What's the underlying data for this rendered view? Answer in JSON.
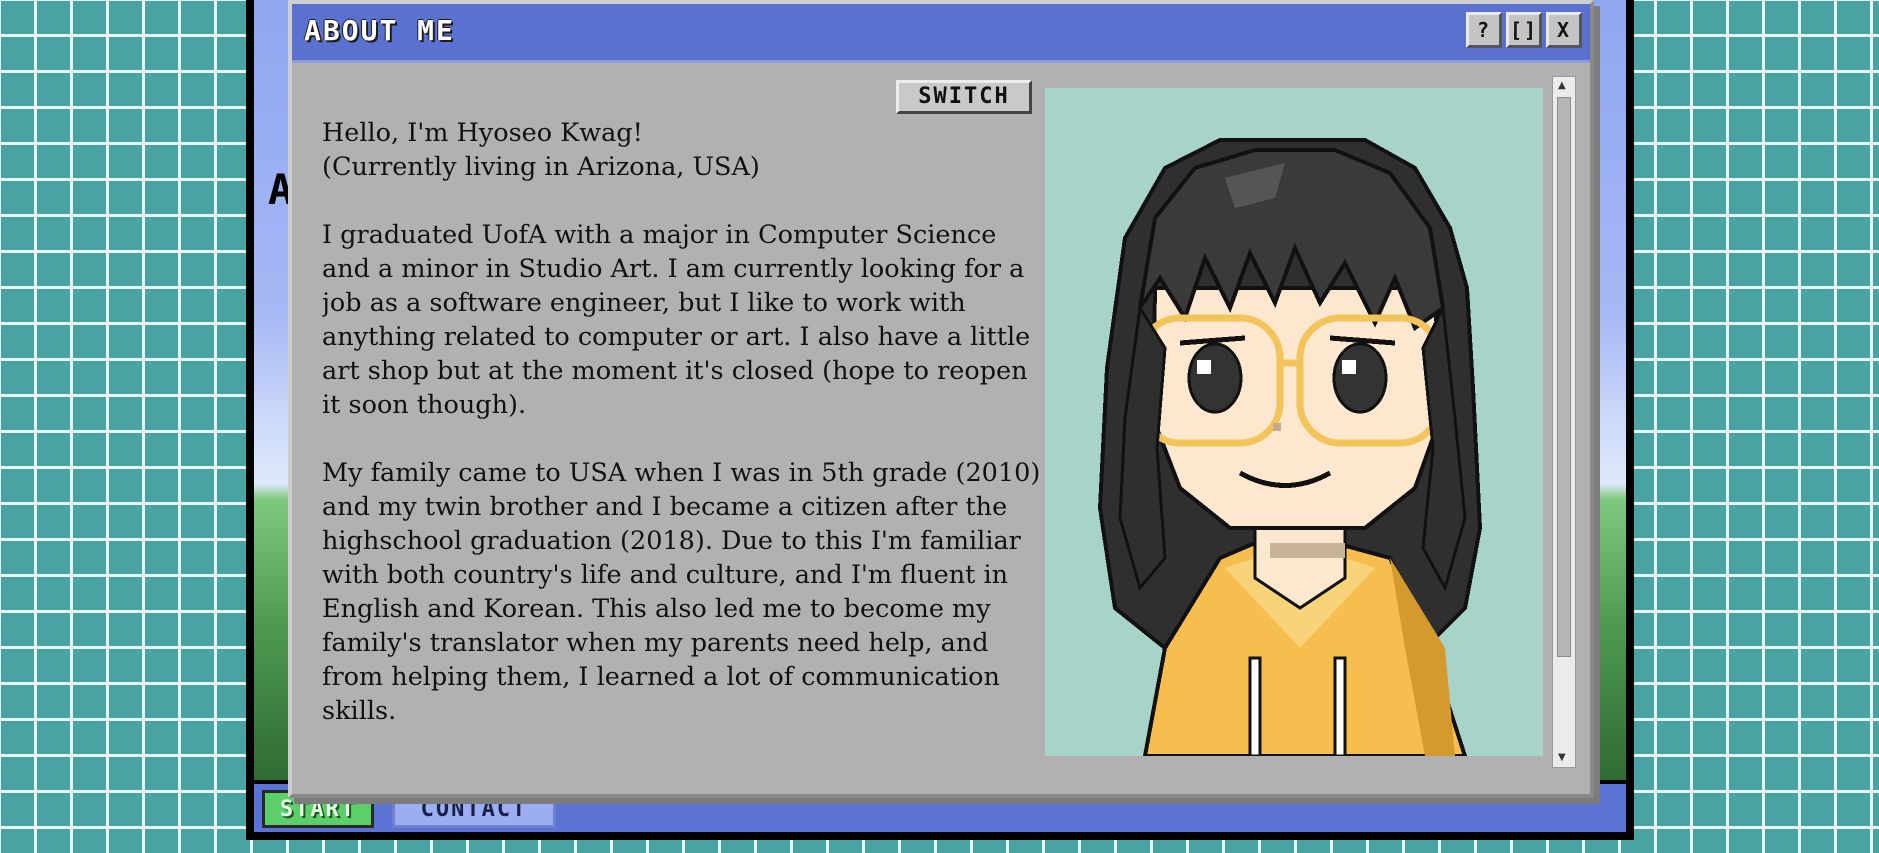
{
  "window": {
    "title": "ABOUT ME",
    "help_label": "?",
    "maximize_label": "[]",
    "close_label": "X"
  },
  "switch_label": "SWITCH",
  "background": {
    "partial_heading": "A"
  },
  "taskbar": {
    "start_label": "START",
    "contact_label": "CONTACT"
  },
  "about": {
    "intro": "Hello, I'm Hyoseo Kwag!\n(Currently living in Arizona, USA)",
    "career": "I graduated UofA with a major in Computer Science and a minor in Studio Art. I am currently looking for a job as a software engineer, but I like to work with anything related to computer or art. I also have a little art shop but at the moment it's closed (hope to reopen it soon though).",
    "family": "My family came to USA when I was in 5th grade (2010) and my twin brother and I became a citizen after the highschool graduation (2018). Due to this I'm familiar with both country's life and culture, and I'm fluent in English and Korean. This also led me to become my family's translator when my parents need help, and from helping them, I learned a lot of communication skills."
  },
  "colors": {
    "desktop": "#4aa3a3",
    "titlebar": "#5a71d0",
    "window": "#b1b1b1",
    "portrait_bg": "#a7d3c8",
    "hair": "#2f2f2f",
    "skin": "#fde8cf",
    "glasses": "#f2c45a",
    "hoodie": "#f5be4f",
    "start": "#5ccf6a"
  },
  "icons": {
    "help": "question-mark",
    "maximize": "maximize-brackets",
    "close": "close-x"
  }
}
